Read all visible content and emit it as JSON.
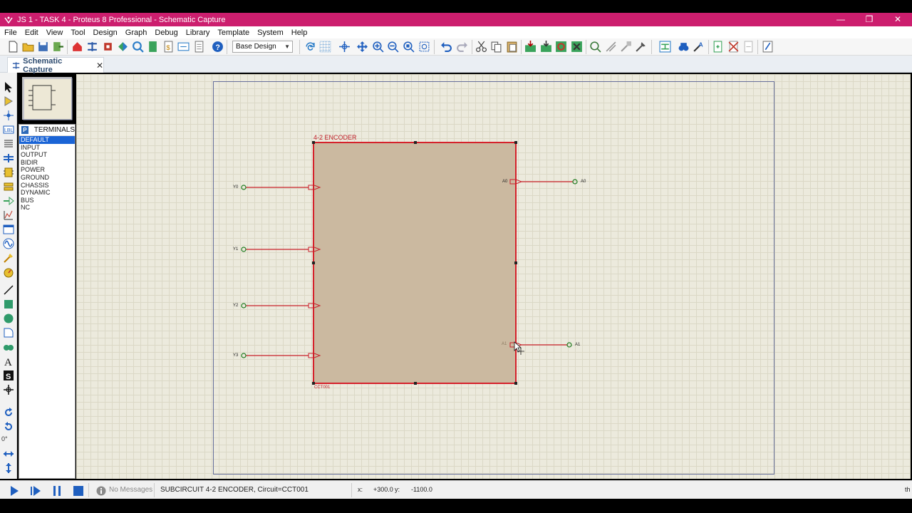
{
  "window": {
    "title": "JS 1 - TASK 4 - Proteus 8 Professional - Schematic Capture",
    "controls": [
      "—",
      "❐",
      "✕"
    ]
  },
  "menu": [
    "File",
    "Edit",
    "View",
    "Tool",
    "Design",
    "Graph",
    "Debug",
    "Library",
    "Template",
    "System",
    "Help"
  ],
  "toolbar": {
    "design_select": "Base Design"
  },
  "tab": {
    "label": "Schematic Capture",
    "close": "✕"
  },
  "terminals_panel": {
    "badge": "P",
    "title": "TERMINALS",
    "items": [
      "DEFAULT",
      "INPUT",
      "OUTPUT",
      "BIDIR",
      "POWER",
      "GROUND",
      "CHASSIS",
      "DYNAMIC",
      "BUS",
      "NC"
    ],
    "selected": "DEFAULT"
  },
  "left_tools": {
    "angle_label": "0°"
  },
  "schematic": {
    "block_title": "4-2 ENCODER",
    "block_ref": "CCT001",
    "inputs": [
      "Y0",
      "Y1",
      "Y2",
      "Y3"
    ],
    "output_pin_labels": [
      "A0",
      "A1"
    ],
    "output_terminals": [
      "A0",
      "A1"
    ],
    "colors": {
      "block_fill": "#cbb9a0",
      "block_border": "#d5212b",
      "wire": "#c8202a",
      "terminal": "#1d7a1d"
    }
  },
  "status": {
    "messages": "No Messages",
    "selection": "SUBCIRCUIT 4-2 ENCODER, Circuit=CCT001",
    "coord_x_label": "x:",
    "coord_x": "+300.0",
    "coord_y_label": "y:",
    "coord_y": "-1100.0",
    "right_text": "th"
  }
}
